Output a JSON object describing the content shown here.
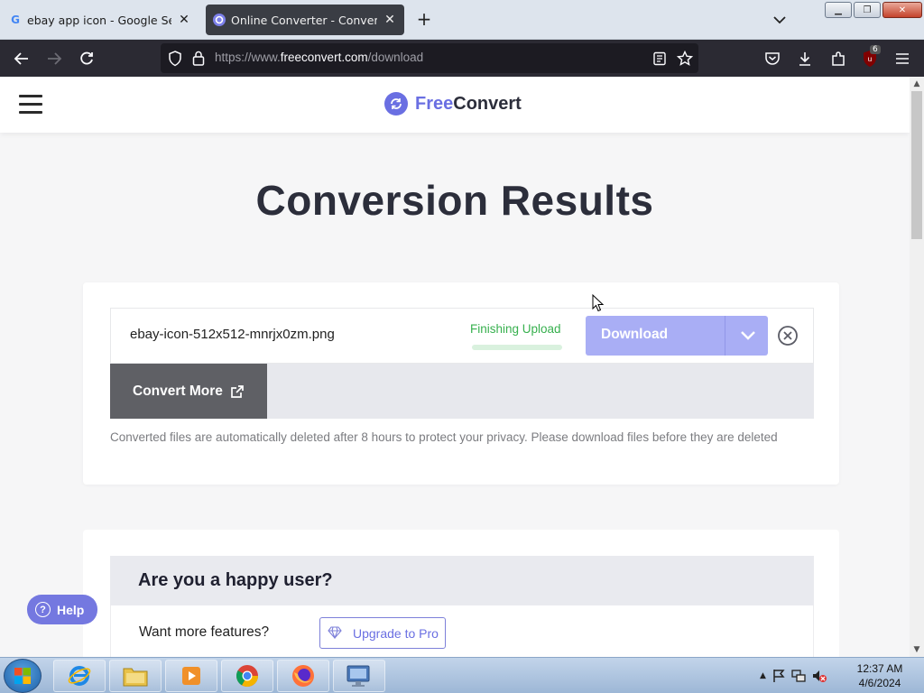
{
  "browser": {
    "tabs": [
      {
        "title": "ebay app icon - Google Search",
        "favicon": "google-icon",
        "active": false
      },
      {
        "title": "Online Converter - Convert Ima",
        "favicon": "freeconvert-icon",
        "active": true
      }
    ],
    "address": {
      "prefix": "https://www.",
      "domain": "freeconvert.com",
      "path": "/download"
    },
    "extension_badge": "6"
  },
  "site": {
    "logo_free": "Free",
    "logo_convert": "Convert",
    "heading": "Conversion Results",
    "file": {
      "name": "ebay-icon-512x512-mnrjx0zm.png",
      "status": "Finishing Upload",
      "progress_fraction": 0.0,
      "download_label": "Download"
    },
    "convert_more_label": "Convert More",
    "privacy_note": "Converted files are automatically deleted after 8 hours to protect your privacy. Please download files before they are deleted",
    "happy": {
      "title": "Are you a happy user?",
      "want_more": "Want more features?",
      "upgrade_label": "Upgrade to Pro"
    },
    "help_label": "Help"
  },
  "colors": {
    "accent": "#6a6fe2",
    "download_button": "#a9aef5",
    "status_green": "#37b04e",
    "convert_more_bg": "#5f6065"
  },
  "taskbar": {
    "time": "12:37 AM",
    "date": "4/6/2024",
    "apps": [
      "internet-explorer-icon",
      "file-explorer-icon",
      "media-player-icon",
      "chrome-icon",
      "firefox-icon",
      "remote-desktop-icon"
    ]
  }
}
